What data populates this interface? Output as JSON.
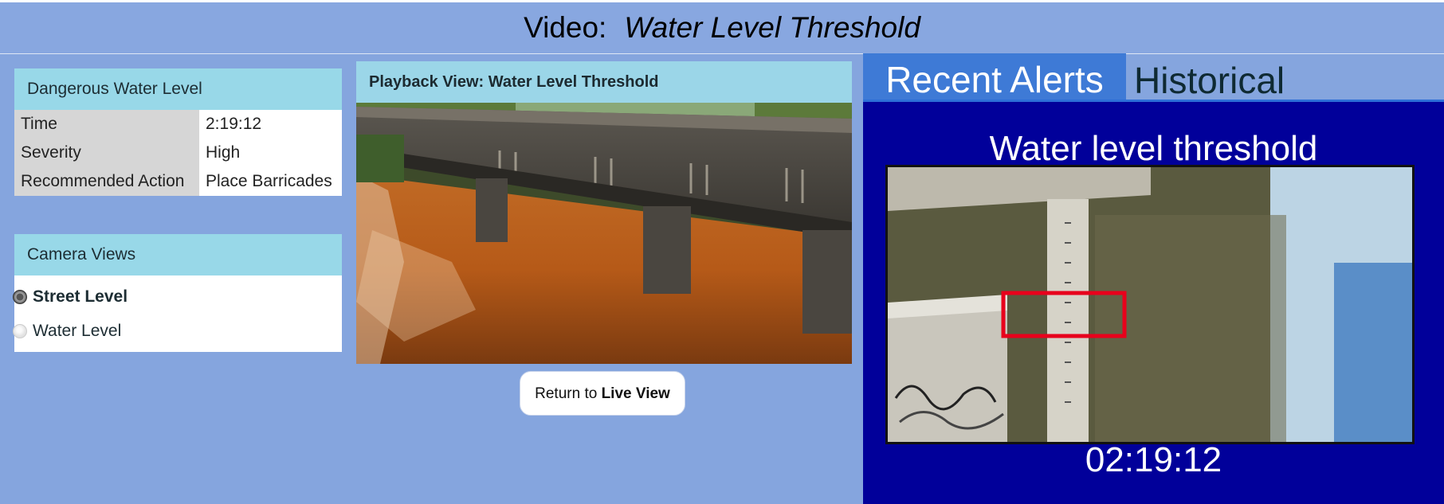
{
  "header": {
    "prefix": "Video:",
    "title": "Water Level Threshold"
  },
  "alert_details": {
    "heading": "Dangerous Water Level",
    "rows": [
      {
        "label": "Time",
        "value": "2:19:12"
      },
      {
        "label": "Severity",
        "value": "High"
      },
      {
        "label": "Recommended Action",
        "value": "Place Barricades"
      }
    ]
  },
  "camera_views": {
    "heading": "Camera Views",
    "options": [
      {
        "label": "Street Level",
        "selected": true
      },
      {
        "label": "Water Level",
        "selected": false
      }
    ]
  },
  "playback": {
    "heading": "Playback View: Water Level Threshold"
  },
  "live_button": {
    "prefix": "Return to",
    "emphasis": "Live View"
  },
  "tabs": {
    "recent": "Recent Alerts",
    "historical": "Historical"
  },
  "recent_alert": {
    "title": "Water level threshold",
    "timestamp": "02:19:12"
  },
  "colors": {
    "page_bg": "#85a5de",
    "panel_header": "#98d8e8",
    "active_tab": "#3e7ad6",
    "alerts_bg": "#01009a",
    "highlight_box": "#e8001c"
  }
}
